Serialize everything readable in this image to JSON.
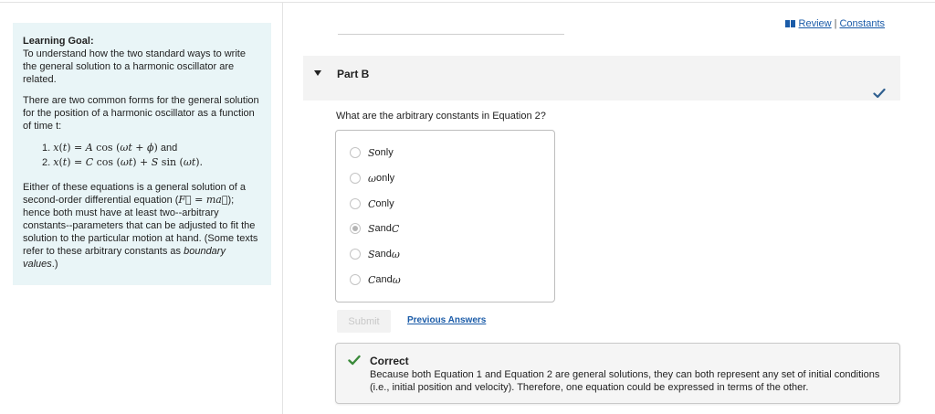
{
  "goal": {
    "title": "Learning Goal:",
    "intro": "To understand how the two standard ways to write the general solution to a harmonic oscillator are related.",
    "para1": "There are two common forms for the general solution for the position of a harmonic oscillator as a function of time t:",
    "eq1_num": "1.",
    "eq1_and": "and",
    "eq2_num": "2.",
    "para2_a": "Either of these equations is a general solution of a second-order differential equation (",
    "para2_b": "); hence both must have at least two--arbitrary constants--parameters that can be adjusted to fit the solution to the particular motion at hand. (Some texts refer to these arbitrary constants as ",
    "para2_em": "boundary values",
    "para2_c": ".)"
  },
  "header": {
    "review_label": "Review",
    "separator": "|",
    "constants_label": "Constants"
  },
  "part": {
    "title": "Part B",
    "question": "What are the arbitrary constants in Equation 2?"
  },
  "options": [
    {
      "sym1": "S",
      "text": " only",
      "sym2": ""
    },
    {
      "sym1": "ω",
      "text": " only",
      "sym2": ""
    },
    {
      "sym1": "C",
      "text": " only",
      "sym2": ""
    },
    {
      "sym1": "S",
      "text": " and ",
      "sym2": "C"
    },
    {
      "sym1": "S",
      "text": " and ",
      "sym2": "ω"
    },
    {
      "sym1": "C",
      "text": " and ",
      "sym2": "ω"
    }
  ],
  "selected_option": 3,
  "actions": {
    "submit_label": "Submit",
    "previous_answers_label": "Previous Answers"
  },
  "feedback": {
    "title": "Correct",
    "text": "Because both Equation 1 and Equation 2 are general solutions, they can both represent any set of initial conditions (i.e., initial position and velocity). Therefore, one equation could be expressed in terms of the other."
  },
  "colors": {
    "link": "#1a5ba8",
    "check_blue": "#2f5f8f",
    "check_green": "#3a8a3a",
    "goal_bg": "#e9f5f7"
  }
}
